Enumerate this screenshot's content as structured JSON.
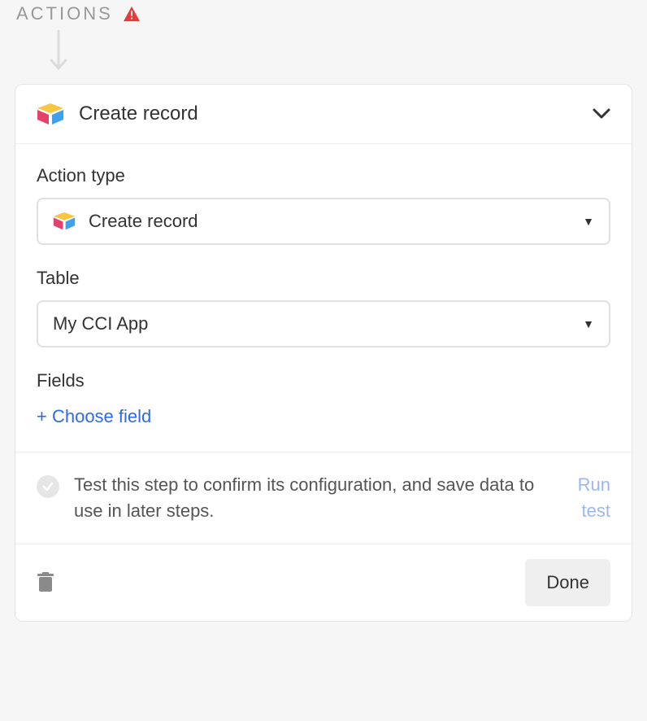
{
  "section": {
    "title": "ACTIONS"
  },
  "action": {
    "header_title": "Create record",
    "action_type_label": "Action type",
    "action_type_value": "Create record",
    "table_label": "Table",
    "table_value": "My CCI App",
    "fields_label": "Fields",
    "choose_field_label": "+ Choose field",
    "test_text": "Test this step to confirm its configuration, and save data to use in later steps.",
    "run_test_label": "Run test",
    "done_label": "Done"
  }
}
